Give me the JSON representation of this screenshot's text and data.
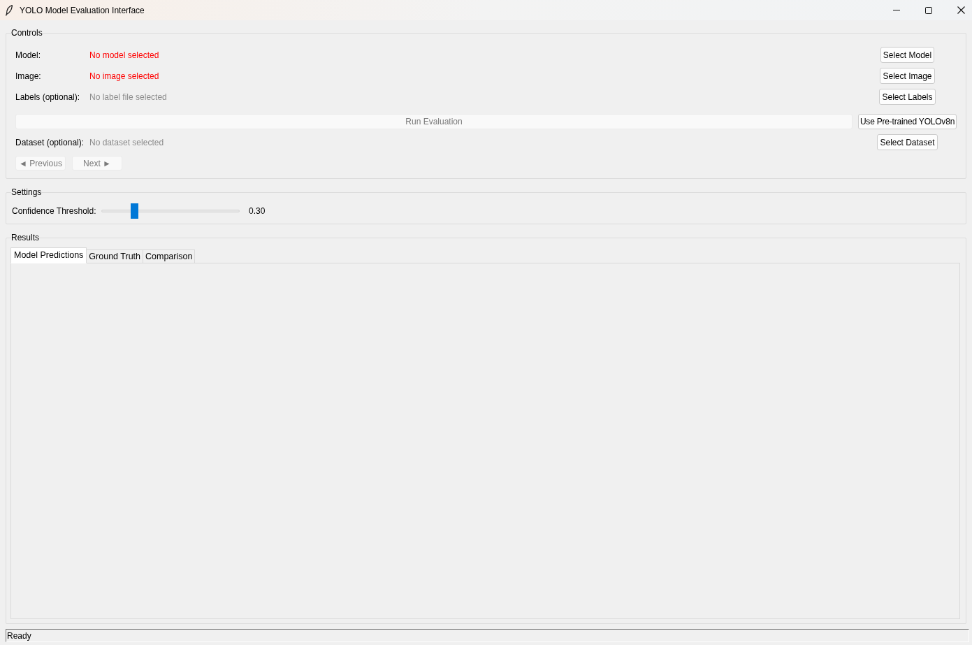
{
  "window": {
    "title": "YOLO Model Evaluation Interface"
  },
  "controls": {
    "title": "Controls",
    "rows": [
      {
        "kind": "file",
        "label": "Model:",
        "value": "No model selected",
        "required": true,
        "button": {
          "label": "Select Model",
          "disabled": false
        }
      },
      {
        "kind": "file",
        "label": "Image:",
        "value": "No image selected",
        "required": true,
        "button": {
          "label": "Select Image",
          "disabled": false
        }
      },
      {
        "kind": "file",
        "label": "Labels (optional):",
        "value": "No label file selected",
        "required": false,
        "button": {
          "label": "Select Labels",
          "disabled": false
        }
      },
      {
        "kind": "action",
        "button": {
          "label": "Run Evaluation",
          "disabled": true
        },
        "side_button": {
          "label": "Use Pre-trained YOLOv8n",
          "disabled": false
        }
      },
      {
        "kind": "file",
        "label": "Dataset (optional):",
        "value": "No dataset selected",
        "required": false,
        "button": {
          "label": "Select Dataset",
          "disabled": false
        }
      }
    ],
    "navigation": [
      {
        "label": "◄ Previous",
        "disabled": true
      },
      {
        "label": "Next ►",
        "disabled": true
      }
    ]
  },
  "settings": {
    "title": "Settings",
    "sliders": [
      {
        "label": "Confidence Threshold:",
        "level": 0.22,
        "reading": "0.30"
      }
    ]
  },
  "results": {
    "title": "Results",
    "tabs": [
      {
        "label": "Model Predictions",
        "selected": true
      },
      {
        "label": "Ground Truth",
        "selected": false
      },
      {
        "label": "Comparison",
        "selected": false
      }
    ]
  },
  "status_bar": {
    "text": "Ready"
  }
}
